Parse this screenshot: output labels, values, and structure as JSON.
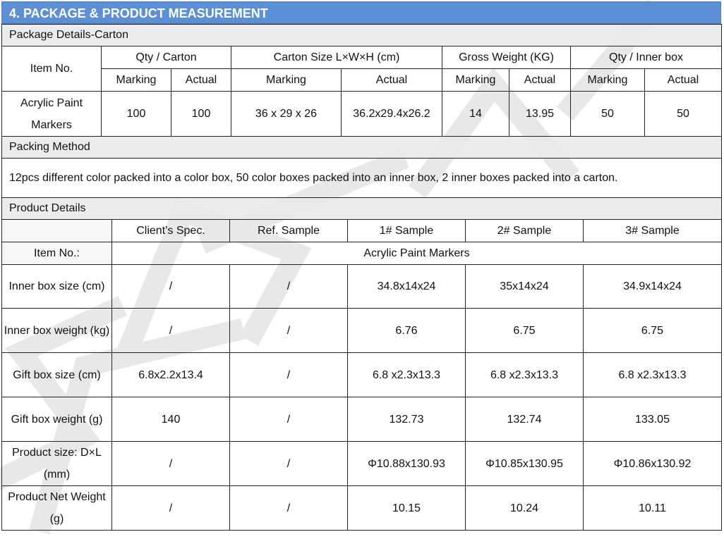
{
  "banner": {
    "title": "4. PACKAGE & PRODUCT MEASUREMENT"
  },
  "package": {
    "section_label": "Package Details-Carton",
    "item_no_header": "Item No.",
    "group_headers": [
      "Qty / Carton",
      "Carton Size L×W×H (cm)",
      "Gross Weight (KG)",
      "Qty / Inner box"
    ],
    "sub_headers": [
      "Marking",
      "Actual",
      "Marking",
      "Actual",
      "Marking",
      "Actual",
      "Marking",
      "Actual"
    ],
    "item_name": "Acrylic Paint Markers",
    "values": [
      "100",
      "100",
      "36 x 29 x 26",
      "36.2x29.4x26.2",
      "14",
      "13.95",
      "50",
      "50"
    ]
  },
  "packing": {
    "section_label": "Packing Method",
    "text": "12pcs different color packed into a color box, 50 color boxes packed into an inner box, 2 inner boxes packed into a carton."
  },
  "product": {
    "section_label": "Product Details",
    "col_headers": [
      "",
      "Client’s Spec.",
      "Ref. Sample",
      "1# Sample",
      "2# Sample",
      "3# Sample"
    ],
    "item_label": "Item No.:",
    "item_name": "Acrylic Paint Markers",
    "rows": [
      {
        "label": "Inner box size (cm)",
        "values": [
          "/",
          "/",
          "34.8x14x24",
          "35x14x24",
          "34.9x14x24"
        ]
      },
      {
        "label": "Inner box weight (kg)",
        "values": [
          "/",
          "/",
          "6.76",
          "6.75",
          "6.75"
        ]
      },
      {
        "label": "Gift box size (cm)",
        "values": [
          "6.8x2.2x13.4",
          "/",
          "6.8 x2.3x13.3",
          "6.8 x2.3x13.3",
          "6.8 x2.3x13.3"
        ]
      },
      {
        "label": "Gift box weight (g)",
        "values": [
          "140",
          "/",
          "132.73",
          "132.74",
          "133.05"
        ]
      },
      {
        "label": "Product size: D×L (mm)",
        "values": [
          "/",
          "/",
          "Φ10.88x130.93",
          "Φ10.85x130.95",
          "Φ10.86x130.92"
        ]
      },
      {
        "label": "Product Net Weight (g)",
        "values": [
          "/",
          "/",
          "10.15",
          "10.24",
          "10.11"
        ]
      }
    ]
  },
  "colors": {
    "banner": "#5b8fd6",
    "section_bg": "#e9e9e9",
    "watermark": "#e8e8e8"
  }
}
